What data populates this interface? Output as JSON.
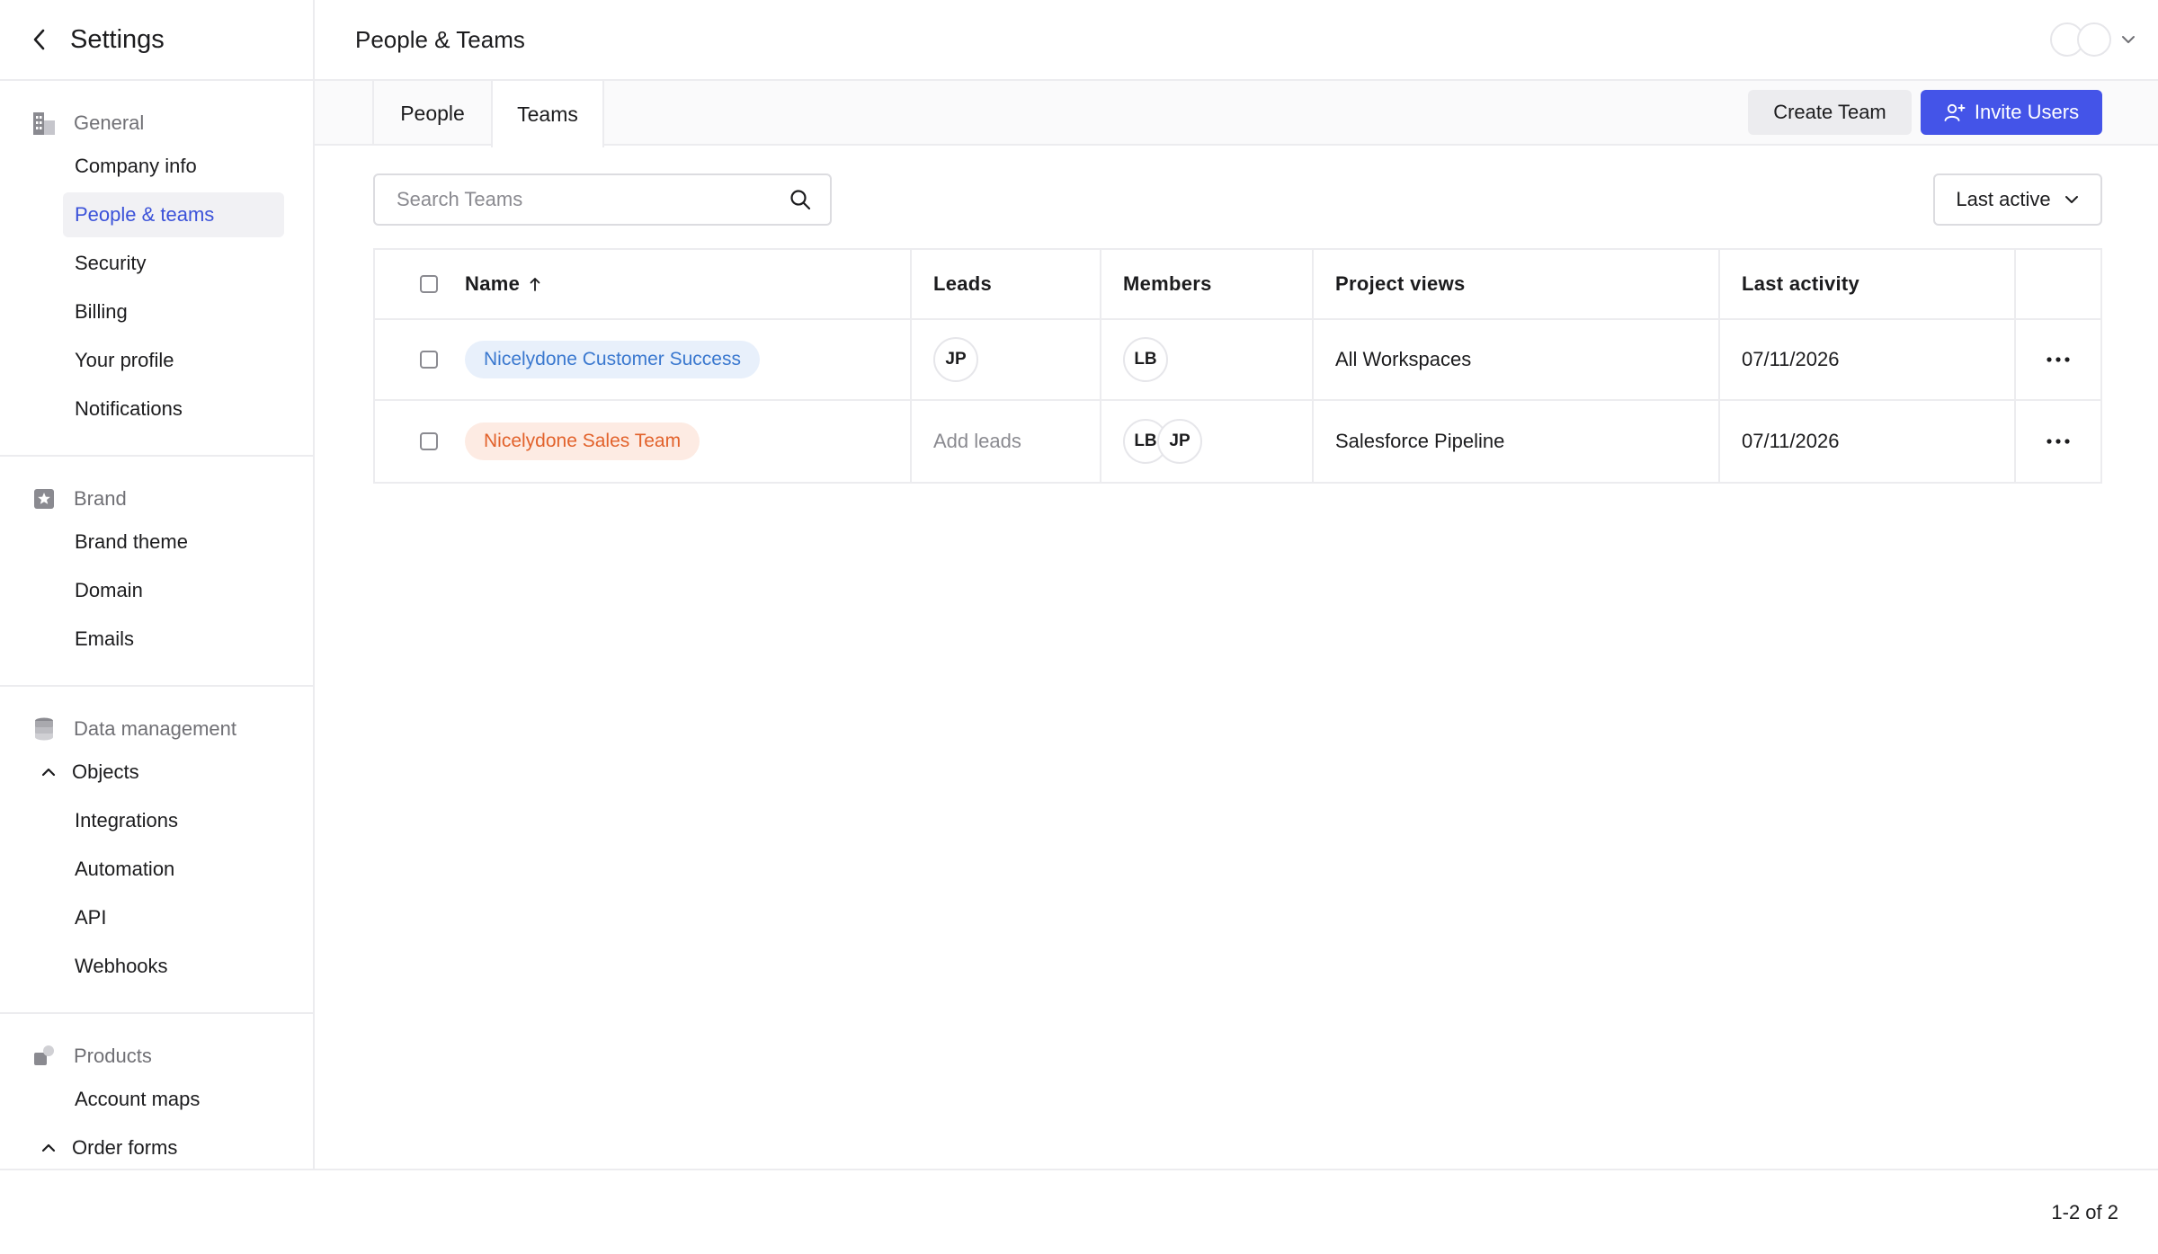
{
  "sidebar": {
    "title": "Settings",
    "groups": [
      {
        "label": "General",
        "icon": "building-icon",
        "items": [
          {
            "label": "Company info",
            "active": false
          },
          {
            "label": "People & teams",
            "active": true
          },
          {
            "label": "Security",
            "active": false
          },
          {
            "label": "Billing",
            "active": false
          },
          {
            "label": "Your profile",
            "active": false
          },
          {
            "label": "Notifications",
            "active": false
          }
        ]
      },
      {
        "label": "Brand",
        "icon": "star-badge-icon",
        "items": [
          {
            "label": "Brand theme"
          },
          {
            "label": "Domain"
          },
          {
            "label": "Emails"
          }
        ]
      },
      {
        "label": "Data management",
        "icon": "database-icon",
        "collapsible": "Objects",
        "items": [
          {
            "label": "Integrations"
          },
          {
            "label": "Automation"
          },
          {
            "label": "API"
          },
          {
            "label": "Webhooks"
          }
        ]
      },
      {
        "label": "Products",
        "icon": "products-icon",
        "items": [
          {
            "label": "Account maps"
          }
        ],
        "collapsible": "Order forms"
      }
    ]
  },
  "header": {
    "title": "People & Teams"
  },
  "tabs": [
    {
      "label": "People",
      "active": false
    },
    {
      "label": "Teams",
      "active": true
    }
  ],
  "actions": {
    "create_team": "Create Team",
    "invite_users": "Invite Users"
  },
  "search": {
    "placeholder": "Search Teams",
    "value": ""
  },
  "sort": {
    "selected": "Last active"
  },
  "table": {
    "columns": [
      "Name",
      "Leads",
      "Members",
      "Project views",
      "Last activity"
    ],
    "rows": [
      {
        "name": "Nicelydone Customer Success",
        "pill_color": "#3a78cf",
        "leads": [
          "JP"
        ],
        "leads_placeholder": "",
        "members": [
          "LB"
        ],
        "project_views": "All Workspaces",
        "last_activity": "07/11/2026"
      },
      {
        "name": "Nicelydone Sales Team",
        "pill_color": "#e2622b",
        "leads": [],
        "leads_placeholder": "Add leads",
        "members": [
          "LB",
          "JP"
        ],
        "project_views": "Salesforce Pipeline",
        "last_activity": "07/11/2026"
      }
    ]
  },
  "pagination": {
    "label": "1-2 of 2"
  },
  "colors": {
    "accent": "#4454e8",
    "active_nav": "#3b52d9"
  }
}
